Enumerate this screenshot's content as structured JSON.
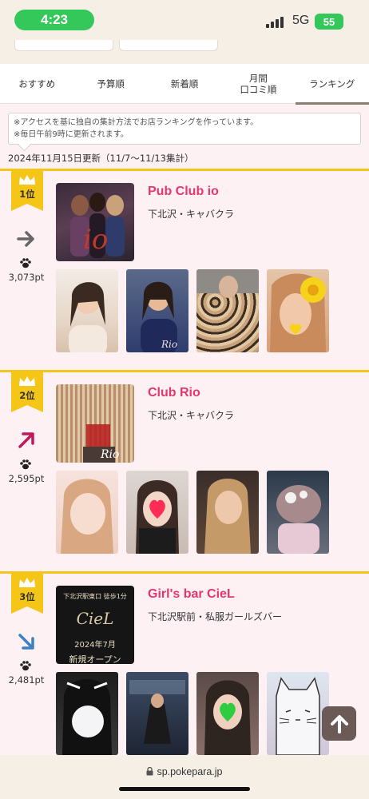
{
  "status_bar": {
    "time": "4:23",
    "network": "5G",
    "battery": "55"
  },
  "tabs": [
    {
      "label": "おすすめ"
    },
    {
      "label": "予算順"
    },
    {
      "label": "新着順"
    },
    {
      "label": "月間\n口コミ順"
    },
    {
      "label": "ランキング",
      "active": true
    }
  ],
  "notice": {
    "line1": "※アクセスを基に独自の集計方法でお店ランキングを作っています。",
    "line2": "※毎日午前9時に更新されます。"
  },
  "updated_text": "2024年11月15日更新（11/7〜11/13集計）",
  "ranking": [
    {
      "rank": "1位",
      "trend": "flat",
      "trend_color": "#666666",
      "points": "3,073pt",
      "name": "Pub Club io",
      "area": "下北沢・キャバクラ"
    },
    {
      "rank": "2位",
      "trend": "up",
      "trend_color": "#c2185b",
      "points": "2,595pt",
      "name": "Club Rio",
      "area": "下北沢・キャバクラ"
    },
    {
      "rank": "3位",
      "trend": "down",
      "trend_color": "#3b7fc4",
      "points": "2,481pt",
      "name": "Girl's bar CieL",
      "area": "下北沢駅前・私服ガールズバー"
    }
  ],
  "ciel_sign": {
    "line1": "下北沢駅東口 徒歩1分",
    "logo": "CieL",
    "date": "2024年7月",
    "open": "新規オープン"
  },
  "colors": {
    "accent": "#e4366f",
    "gold": "#f5c518",
    "background": "#fdf1f4"
  },
  "footer": {
    "url": "sp.pokepara.jp"
  }
}
